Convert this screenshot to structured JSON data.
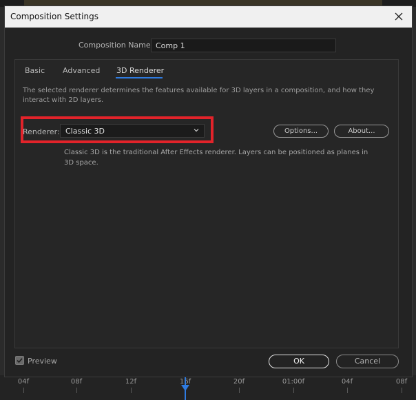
{
  "dialog": {
    "title": "Composition Settings",
    "composition_name_label": "Composition Name:",
    "composition_name_value": "Comp 1"
  },
  "tabs": [
    {
      "label": "Basic",
      "active": false
    },
    {
      "label": "Advanced",
      "active": false
    },
    {
      "label": "3D Renderer",
      "active": true
    }
  ],
  "renderer_tab": {
    "description": "The selected renderer determines the features available for 3D layers in a composition, and how they interact with 2D layers.",
    "renderer_label": "Renderer:",
    "renderer_value": "Classic 3D",
    "options_button": "Options...",
    "about_button": "About...",
    "renderer_description": "Classic 3D is the traditional After Effects renderer. Layers can be positioned as planes in 3D space."
  },
  "footer": {
    "preview_label": "Preview",
    "preview_checked": true,
    "ok_label": "OK",
    "cancel_label": "Cancel"
  },
  "timeline": {
    "ticks": [
      "04f",
      "08f",
      "12f",
      "16f",
      "20f",
      "01:00f",
      "04f",
      "08f"
    ]
  },
  "colors": {
    "accent": "#2f7be0",
    "highlight_box": "#e2232a"
  }
}
